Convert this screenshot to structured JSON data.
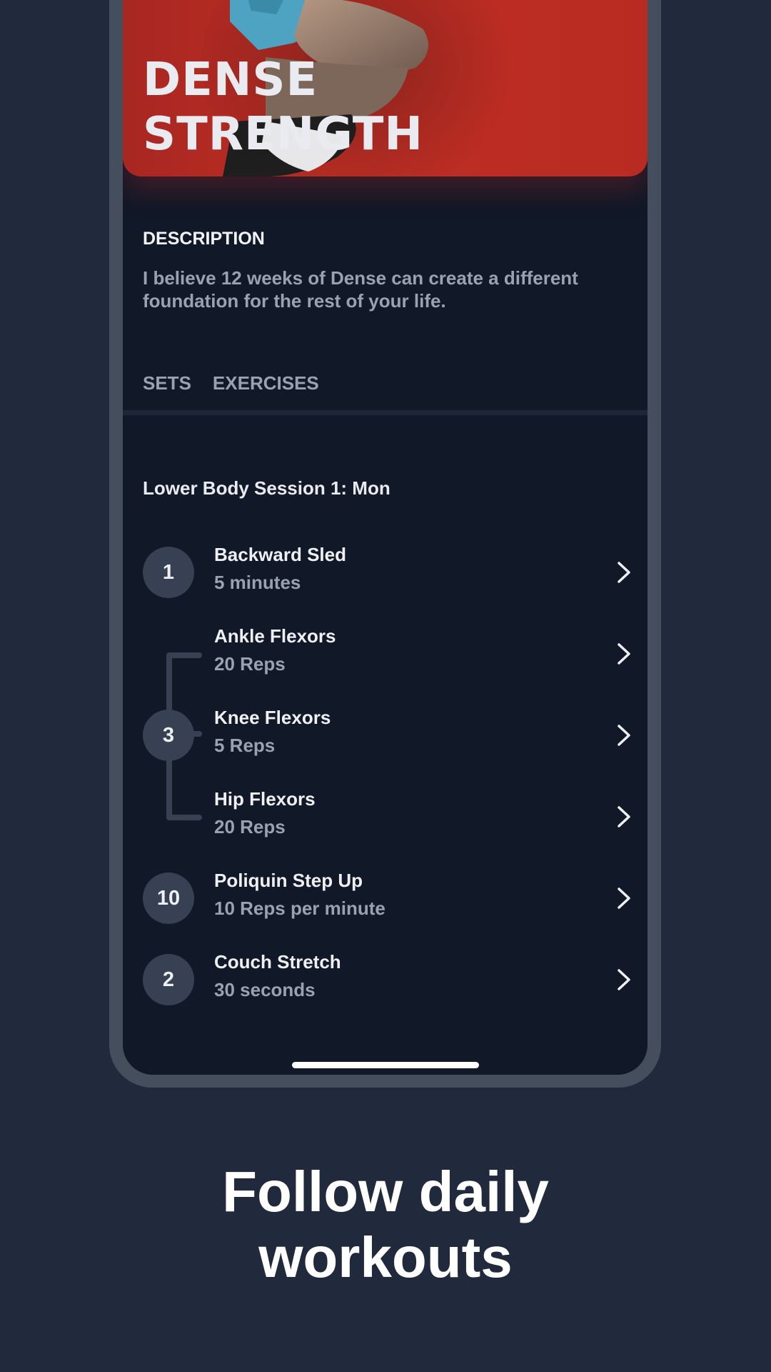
{
  "program": {
    "title_lines": [
      "DENSE",
      "STRENGTH"
    ],
    "hero_image": "athlete-jumping-photo",
    "accent_color": "#bf2e24"
  },
  "description": {
    "heading": "DESCRIPTION",
    "text": "I believe 12 weeks of Dense can create a different foundation for the rest of your life."
  },
  "tabs": [
    {
      "label": "SETS",
      "active": false
    },
    {
      "label": "EXERCISES",
      "active": false
    }
  ],
  "session": {
    "title": "Lower Body Session 1: Mon",
    "exercises": [
      {
        "sets": "1",
        "name": "Backward Sled",
        "detail": "5 minutes",
        "group": null
      },
      {
        "sets": "",
        "name": "Ankle Flexors",
        "detail": "20 Reps",
        "group": "superset-3"
      },
      {
        "sets": "3",
        "name": "Knee Flexors",
        "detail": "5 Reps",
        "group": "superset-3"
      },
      {
        "sets": "",
        "name": "Hip Flexors",
        "detail": "20 Reps",
        "group": "superset-3"
      },
      {
        "sets": "10",
        "name": "Poliquin Step Up",
        "detail": "10 Reps per minute",
        "group": null
      },
      {
        "sets": "2",
        "name": "Couch Stretch",
        "detail": "30 seconds",
        "group": null
      }
    ],
    "row_icon": "chevron-right-icon"
  },
  "caption": {
    "lines": [
      "Follow daily",
      "workouts"
    ]
  }
}
